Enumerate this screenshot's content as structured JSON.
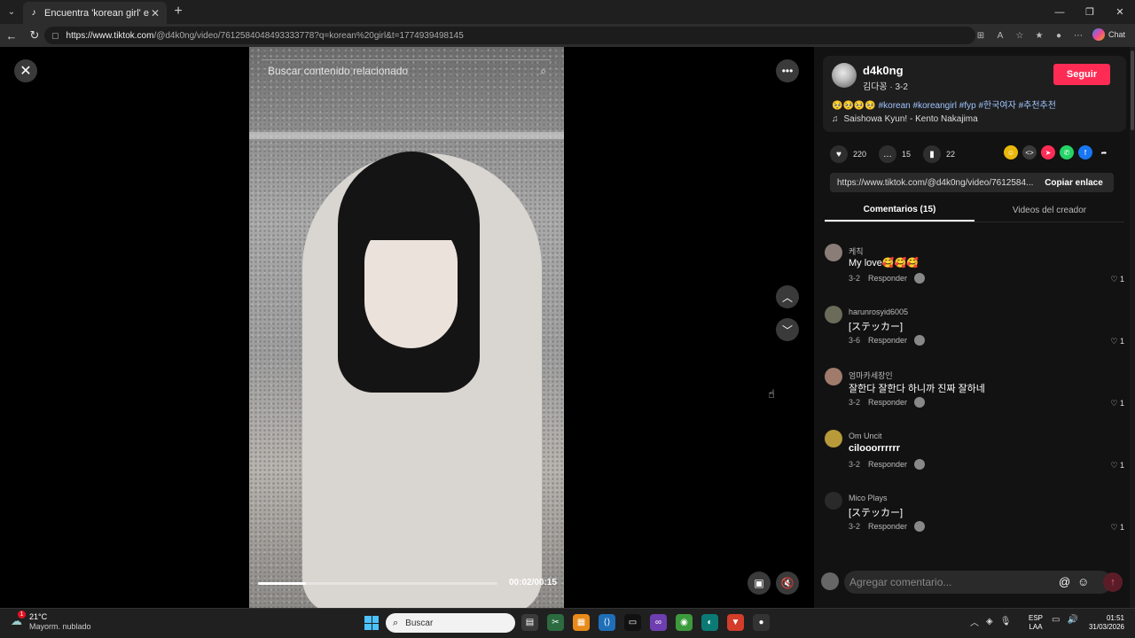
{
  "browser": {
    "tab_title": "Encuentra 'korean girl' en TikTok |",
    "tab_close": "✕",
    "new_tab": "+",
    "url_host": "https://www.tiktok.com",
    "url_path": "/@d4k0ng/video/7612584048493333778?q=korean%20girl&t=1774939498145",
    "chat_label": "Chat"
  },
  "video": {
    "search_placeholder": "Buscar contenido relacionado",
    "time": "00:02/00:15",
    "progress_fraction": 0.2
  },
  "post": {
    "username": "d4k0ng",
    "subtitle": "김다꽁 · 3-2",
    "follow_label": "Seguir",
    "caption_emoji": "🥺🥺🥺🥺",
    "caption_tags": "#korean #koreangirl #fyp #한국여자 #추천추천",
    "music": "Saishowa Kyun! - Kento Nakajima",
    "likes": "220",
    "comments": "15",
    "saves": "22",
    "link": "https://www.tiktok.com/@d4k0ng/video/7612584...",
    "copy_link_label": "Copiar enlace"
  },
  "tabs": {
    "comments": "Comentarios (15)",
    "creator_videos": "Videos del creador"
  },
  "comments": [
    {
      "name": "케칙",
      "text": "My love🥰🥰🥰",
      "date": "3-2",
      "reply": "Responder",
      "likes": "1"
    },
    {
      "name": "harunrosyid6005",
      "text": "[ステッカー]",
      "date": "3-6",
      "reply": "Responder",
      "likes": "1"
    },
    {
      "name": "엄마카세장인",
      "text": "잘한다 잘한다 하니까 진짜 잘하네",
      "date": "3-2",
      "reply": "Responder",
      "likes": "1"
    },
    {
      "name": "Om Uncit",
      "text": "cilooorrrrrr",
      "date": "3-2",
      "reply": "Responder",
      "likes": "1"
    },
    {
      "name": "Mico Plays",
      "text": "[ステッカー]",
      "date": "3-2",
      "reply": "Responder",
      "likes": "1"
    }
  ],
  "composer": {
    "placeholder": "Agregar comentario..."
  },
  "taskbar": {
    "temp": "21°C",
    "weather": "Mayorm. nublado",
    "search": "Buscar",
    "lang1": "ESP",
    "lang2": "LAA",
    "time": "01:51",
    "date": "31/03/2026",
    "weather_badge": "1"
  },
  "colors": {
    "accent": "#fe2c55",
    "tag": "#9fc4ff"
  }
}
